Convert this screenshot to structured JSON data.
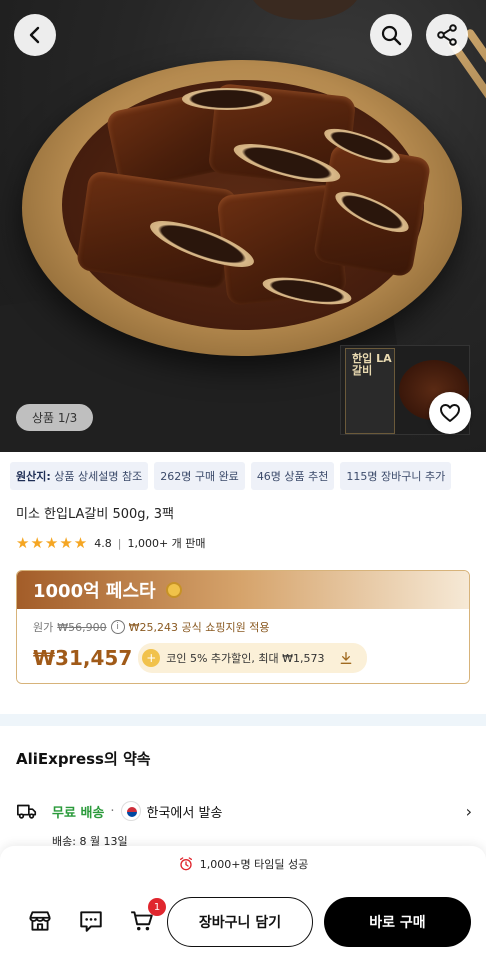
{
  "hero": {
    "counter": "상품 1/3",
    "package_title": "한입 LA갈비"
  },
  "tags": [
    {
      "strong": "원산지:",
      "text": " 상품 상세설명 참조"
    },
    {
      "strong": "",
      "text": "262명 구매 완료"
    },
    {
      "strong": "",
      "text": "46명 상품 추천"
    },
    {
      "strong": "",
      "text": "115명 장바구니 추가"
    }
  ],
  "product": {
    "title": "미소 한입LA갈비 500g, 3팩",
    "stars": "★★★★★",
    "rating": "4.8",
    "sold": "1,000+ 개 판매"
  },
  "deal": {
    "banner": "1000억 페스타",
    "orig_label": "원가",
    "orig_price": "₩56,900",
    "subsidy": "₩25,243 공식 쇼핑지원 적용",
    "price": "₩31,457",
    "coin_text": "코인 5% 추가할인, 최대 ₩1,573",
    "coin_symbol": "+"
  },
  "promise": {
    "title": "AliExpress의 약속",
    "free_shipping": "무료 배송",
    "dot": "·",
    "ship_from": "한국에서 발송",
    "delivery": "배송: 8 월 13일"
  },
  "bottom": {
    "timing": "1,000+명 타임딜 성공",
    "cart_badge": "1",
    "add_to_cart": "장바구니 담기",
    "buy_now": "바로 구매"
  },
  "colors": {
    "price": "#a05a18",
    "free_shipping": "#2a9a3a",
    "buy_button": "#000000",
    "badge": "#e0262e"
  }
}
